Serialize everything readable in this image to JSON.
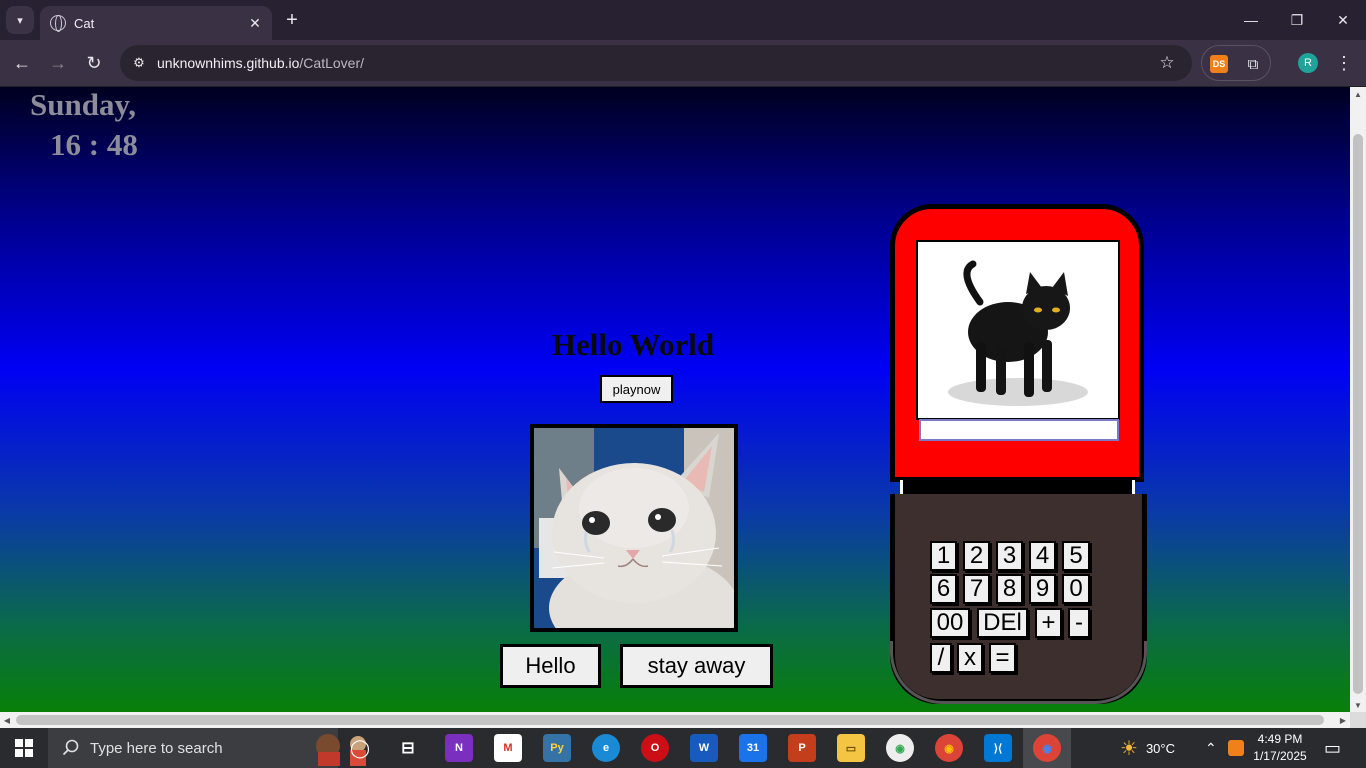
{
  "browser": {
    "tab_title": "Cat",
    "url_host": "unknownhims.github.io",
    "url_path": "/CatLover/",
    "profile_initial": "R",
    "extension_label": "DS"
  },
  "page": {
    "day": "Sunday,",
    "time": "16 : 48",
    "heading": "Hello World",
    "playnow_label": "playnow",
    "hello_label": "Hello",
    "stay_away_label": "stay away",
    "keypad": {
      "row1": [
        "1",
        "2",
        "3",
        "4",
        "5"
      ],
      "row2": [
        "6",
        "7",
        "8",
        "9",
        "0"
      ],
      "row3": [
        "00",
        "DEl",
        "+",
        "-"
      ],
      "row4": [
        "/",
        "x",
        "="
      ]
    }
  },
  "taskbar": {
    "search_placeholder": "Type here to search",
    "temperature": "30°C",
    "time": "4:49 PM",
    "date": "1/17/2025"
  },
  "colors": {
    "phone_red": "#ff0000",
    "phone_body": "#3e2f2f"
  }
}
